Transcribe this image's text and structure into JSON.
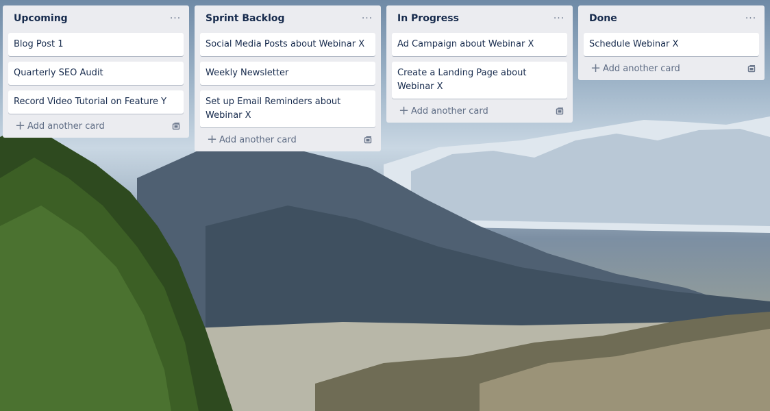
{
  "lists": [
    {
      "title": "Upcoming",
      "menu_icon": "···",
      "cards": [
        "Blog Post 1",
        "Quarterly SEO Audit",
        "Record Video Tutorial on Feature Y"
      ],
      "add_label": "Add another card"
    },
    {
      "title": "Sprint Backlog",
      "menu_icon": "···",
      "cards": [
        "Social Media Posts about Webinar X",
        "Weekly Newsletter",
        "Set up Email Reminders about Webinar X"
      ],
      "add_label": "Add another card"
    },
    {
      "title": "In Progress",
      "menu_icon": "···",
      "cards": [
        "Ad Campaign about Webinar X",
        "Create a Landing Page about Webinar X"
      ],
      "add_label": "Add another card"
    },
    {
      "title": "Done",
      "menu_icon": "···",
      "cards": [
        "Schedule Webinar X"
      ],
      "add_label": "Add another card"
    }
  ],
  "icons": {
    "list_menu": "more-horizontal-icon",
    "add": "plus-icon",
    "template": "card-template-icon"
  },
  "colors": {
    "list_background": "#ebecf0",
    "card_background": "#ffffff",
    "title_text": "#172b4d",
    "muted_text": "#5e6c84"
  }
}
